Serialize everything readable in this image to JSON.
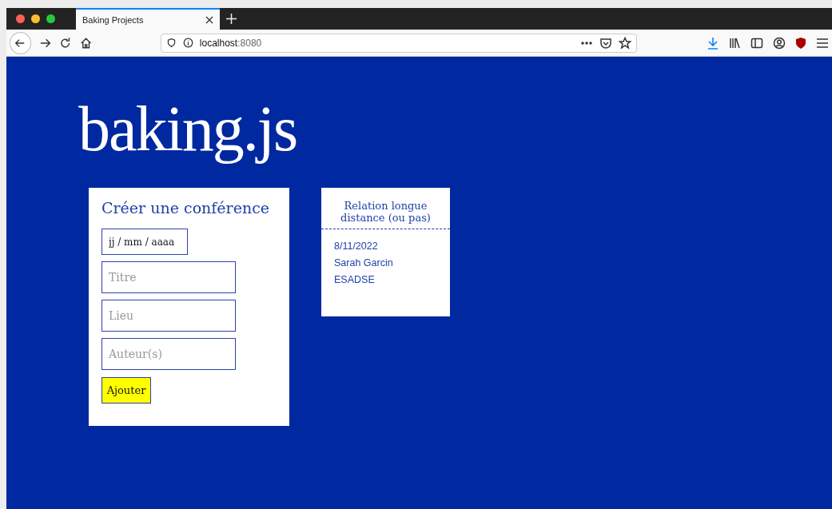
{
  "browser": {
    "tab": {
      "title": "Baking Projects",
      "selected": true
    },
    "url": {
      "host": "localhost",
      "port": ":8080"
    }
  },
  "logo": "baking.js",
  "form": {
    "title": "Créer une conférence",
    "date_field": {
      "placeholder": "jj / mm / aaaa"
    },
    "fields": [
      {
        "placeholder": "Titre"
      },
      {
        "placeholder": "Lieu"
      },
      {
        "placeholder": "Auteur(s)"
      }
    ],
    "button": "Ajouter"
  },
  "conferences": [
    {
      "title": "Relation longue distance (ou pas)",
      "date": "8/11/2022",
      "author": "Sarah Garcin",
      "place": "ESADSE"
    }
  ]
}
